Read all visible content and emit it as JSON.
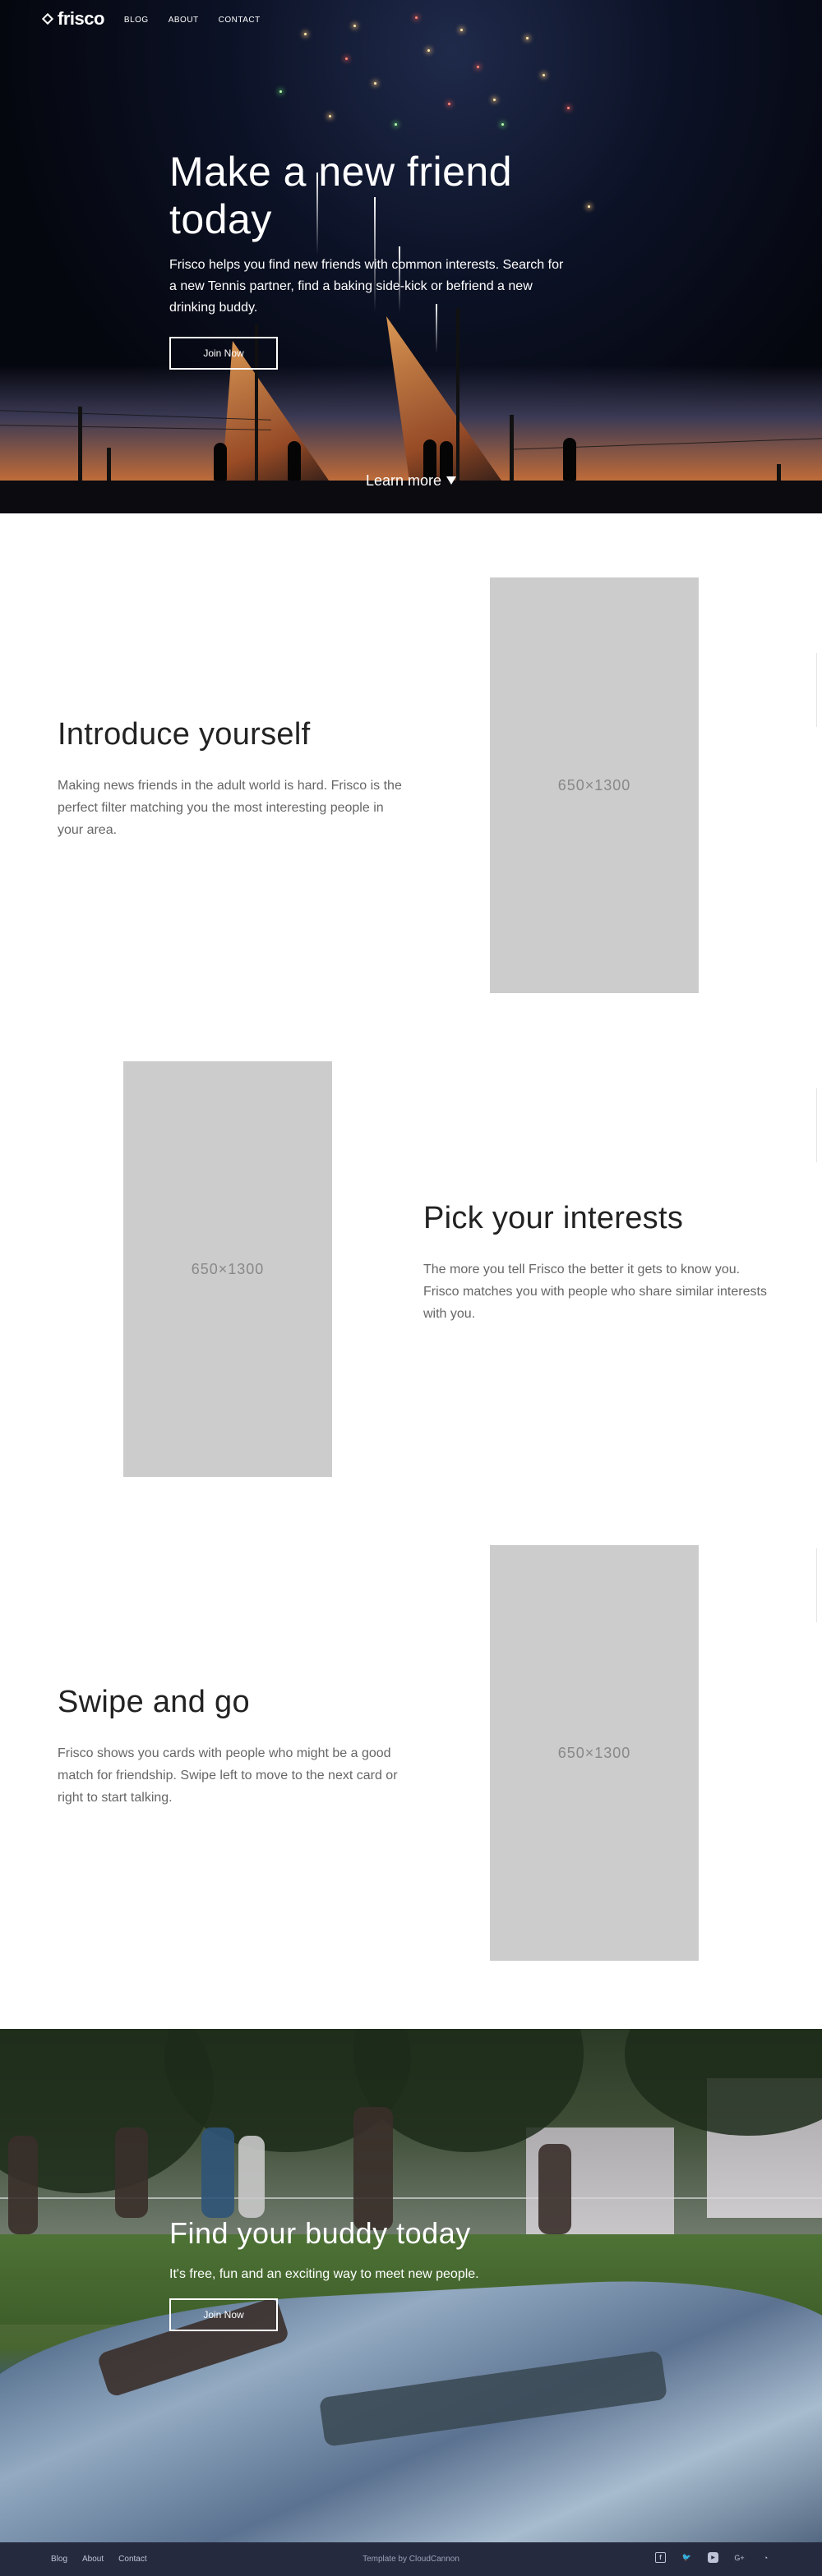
{
  "nav": {
    "brand": "frisco",
    "links": [
      "BLOG",
      "ABOUT",
      "CONTACT"
    ]
  },
  "hero": {
    "title": "Make a new friend today",
    "text": "Frisco helps you find new friends with common interests. Search for a new Tennis partner, find a baking side-kick or befriend a new drinking buddy.",
    "button": "Join Now",
    "learn_more": "Learn more"
  },
  "features": [
    {
      "title": "Introduce yourself",
      "text": "Making news friends in the adult world is hard. Frisco is the perfect filter matching you the most interesting people in your area.",
      "image_label": "650×1300"
    },
    {
      "title": "Pick your interests",
      "text": "The more you tell Frisco the better it gets to know you. Frisco matches you with people who share similar interests with you.",
      "image_label": "650×1300"
    },
    {
      "title": "Swipe and go",
      "text": "Frisco shows you cards with people who might be a good match for friendship. Swipe left to move to the next card or right to start talking.",
      "image_label": "650×1300"
    }
  ],
  "cta": {
    "title": "Find your buddy today",
    "text": "It's free, fun and an exciting way to meet new people.",
    "button": "Join Now"
  },
  "footer": {
    "links": [
      "Blog",
      "About",
      "Contact"
    ],
    "credit": "Template by CloudCannon",
    "social_icons": [
      "facebook-icon",
      "twitter-icon",
      "youtube-icon",
      "google-plus-icon",
      "rss-icon"
    ],
    "social_glyphs": [
      "f",
      "🐦",
      "▶",
      "G+",
      "◔"
    ]
  }
}
